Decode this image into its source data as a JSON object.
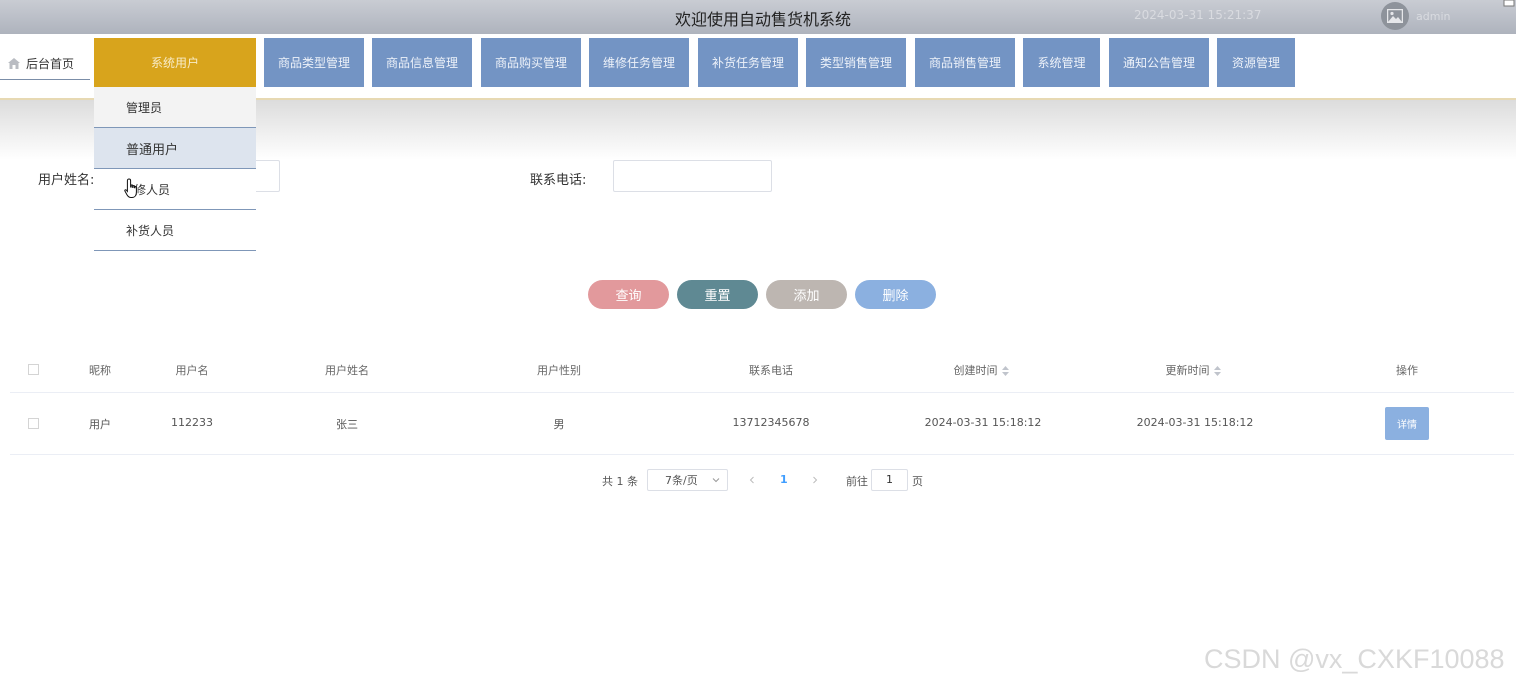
{
  "header": {
    "title": "欢迎使用自动售货机系统",
    "datetime": "2024-03-31 15:21:37",
    "username": "admin"
  },
  "nav": {
    "home_label": "后台首页",
    "items": [
      "系统用户",
      "商品类型管理",
      "商品信息管理",
      "商品购买管理",
      "维修任务管理",
      "补货任务管理",
      "类型销售管理",
      "商品销售管理",
      "系统管理",
      "通知公告管理",
      "资源管理"
    ],
    "active_index": 0
  },
  "dropdown": {
    "items": [
      "管理员",
      "普通用户",
      "维修人员",
      "补货人员"
    ],
    "hovered_index": 1,
    "visible_item_2_tail": "修人员"
  },
  "search": {
    "name_label": "用户姓名:",
    "name_value": "",
    "phone_label": "联系电话:",
    "phone_value": ""
  },
  "actions": {
    "query": "查询",
    "reset": "重置",
    "add": "添加",
    "delete": "删除"
  },
  "table": {
    "columns": [
      "昵称",
      "用户名",
      "用户姓名",
      "用户性别",
      "联系电话",
      "创建时间",
      "更新时间",
      "操作"
    ],
    "rows": [
      {
        "nickname": "用户",
        "username": "112233",
        "real_name": "张三",
        "gender": "男",
        "phone": "13712345678",
        "created": "2024-03-31 15:18:12",
        "updated": "2024-03-31 15:18:12",
        "action": "详情"
      }
    ]
  },
  "pagination": {
    "total_text": "共 1 条",
    "page_size": "7条/页",
    "current_page": "1",
    "goto_label": "前往",
    "goto_value": "1",
    "page_unit": "页"
  },
  "watermark": "CSDN @vx_CXKF10088",
  "colors": {
    "nav_item": "#7394c4",
    "nav_active": "#d8a41c",
    "btn_query": "#e2999c",
    "btn_reset": "#5f8993",
    "btn_add": "#bdb6b1",
    "btn_delete": "#8bb0e0"
  }
}
